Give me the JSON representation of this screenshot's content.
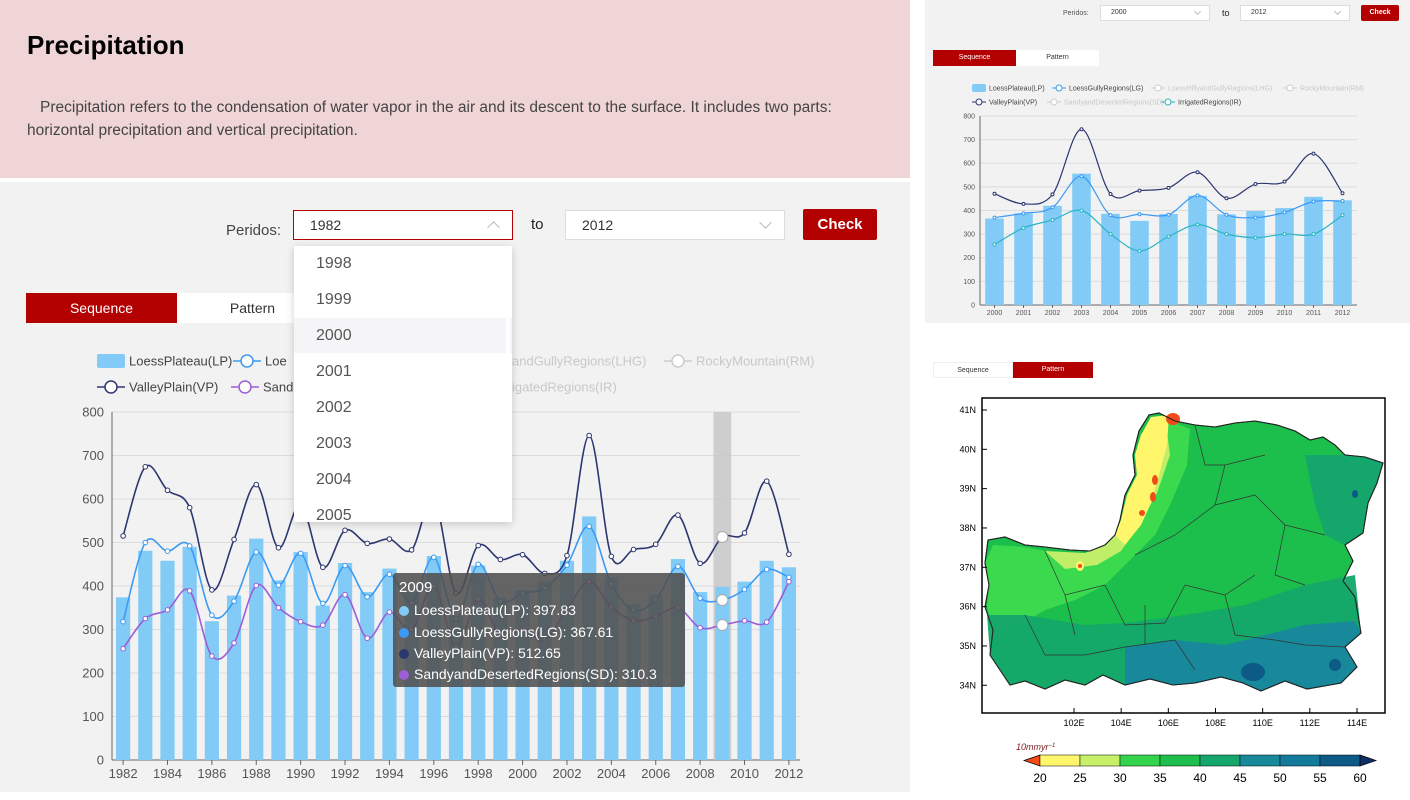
{
  "header": {
    "title": "Precipitation",
    "description": "Precipitation refers to the condensation of water vapor in the air and its descent to the surface. It includes two parts: horizontal precipitation and vertical precipitation."
  },
  "left": {
    "periods_label": "Peridos:",
    "from_value": "1982",
    "to_label": "to",
    "to_value": "2012",
    "check_label": "Check",
    "tabs": [
      "Sequence",
      "Pattern"
    ],
    "dropdown_options": [
      "1998",
      "1999",
      "2000",
      "2001",
      "2002",
      "2003",
      "2004",
      "2005"
    ],
    "legend": [
      {
        "text": "LoessPlateau(LP)",
        "style": "bar",
        "color": "#82cbf7",
        "dim": false
      },
      {
        "text": "Loe",
        "style": "line",
        "color": "#3b9af3",
        "dim": false
      },
      {
        "text": "andGullyRegions(LHG)",
        "style": "none",
        "color": "#cccccc",
        "dim": true
      },
      {
        "text": "RockyMountain(RM)",
        "style": "line",
        "color": "#cccccc",
        "dim": true
      },
      {
        "text": "ValleyPlain(VP)",
        "style": "line",
        "color": "#2c3670",
        "dim": false
      },
      {
        "text": "Sand",
        "style": "line",
        "color": "#9b5ed6",
        "dim": false
      },
      {
        "text": "igatedRegions(IR)",
        "style": "none",
        "color": "#cccccc",
        "dim": true
      }
    ],
    "tooltip": {
      "title": "2009",
      "rows": [
        {
          "text": "LoessPlateau(LP): 397.83",
          "color": "#82cbf7"
        },
        {
          "text": "LoessGullyRegions(LG): 367.61",
          "color": "#3b9af3"
        },
        {
          "text": "ValleyPlain(VP): 512.65",
          "color": "#2c3670"
        },
        {
          "text": "SandyandDesertedRegions(SD): 310.3",
          "color": "#9b5ed6"
        }
      ]
    }
  },
  "chart_data": [
    {
      "type": "bar",
      "x": [
        1982,
        1983,
        1984,
        1985,
        1986,
        1987,
        1988,
        1989,
        1990,
        1991,
        1992,
        1993,
        1994,
        1995,
        1996,
        1997,
        1998,
        1999,
        2000,
        2001,
        2002,
        2003,
        2004,
        2005,
        2006,
        2007,
        2008,
        2009,
        2010,
        2011,
        2012
      ],
      "ylim": [
        0,
        800
      ],
      "yticks": [
        0,
        100,
        200,
        300,
        400,
        500,
        600,
        700,
        800
      ],
      "xticks": [
        1982,
        1984,
        1986,
        1988,
        1990,
        1992,
        1994,
        1996,
        1998,
        2000,
        2002,
        2004,
        2006,
        2008,
        2010,
        2012
      ],
      "highlight_x": 2009,
      "series": [
        {
          "name": "LoessPlateau(LP)",
          "type": "bar",
          "color": "#82cbf7",
          "values": [
            374,
            481,
            458,
            490,
            319,
            378,
            509,
            413,
            478,
            355,
            453,
            386,
            440,
            387,
            469,
            331,
            447,
            373,
            391,
            411,
            458,
            560,
            420,
            358,
            380,
            462,
            386,
            398,
            410,
            458,
            443
          ]
        },
        {
          "name": "LoessGullyRegions(LG)",
          "type": "line",
          "color": "#3b9af3",
          "values": [
            318,
            500,
            480,
            492,
            333,
            365,
            478,
            402,
            475,
            360,
            447,
            375,
            427,
            362,
            466,
            325,
            450,
            365,
            383,
            395,
            448,
            537,
            405,
            345,
            368,
            445,
            372,
            367.61,
            392,
            438,
            420
          ]
        },
        {
          "name": "ValleyPlain(VP)",
          "type": "line",
          "color": "#2c3670",
          "values": [
            515,
            674,
            620,
            580,
            391,
            507,
            633,
            488,
            587,
            443,
            528,
            498,
            508,
            483,
            601,
            384,
            493,
            461,
            472,
            429,
            470,
            746,
            468,
            484,
            496,
            563,
            452,
            512.65,
            522,
            641,
            473
          ]
        },
        {
          "name": "SandyandDesertedRegions(SD)",
          "type": "line",
          "color": "#9b5ed6",
          "values": [
            256,
            325,
            345,
            389,
            239,
            269,
            401,
            350,
            318,
            310,
            380,
            280,
            340,
            300,
            400,
            260,
            370,
            286,
            300,
            276,
            347,
            410,
            352,
            320,
            330,
            350,
            304,
            310.3,
            320,
            317,
            410
          ]
        }
      ]
    },
    {
      "type": "bar",
      "x": [
        2000,
        2001,
        2002,
        2003,
        2004,
        2005,
        2006,
        2007,
        2008,
        2009,
        2010,
        2011,
        2012
      ],
      "ylim": [
        0,
        800
      ],
      "yticks": [
        0,
        100,
        200,
        300,
        400,
        500,
        600,
        700,
        800
      ],
      "series": [
        {
          "name": "LoessPlateau(LP)",
          "type": "bar",
          "color": "#82cbf7",
          "values": [
            366,
            388,
            420,
            556,
            386,
            356,
            385,
            462,
            384,
            398,
            410,
            458,
            443
          ]
        },
        {
          "name": "LoessGullyRegions(LG)",
          "type": "line",
          "color": "#3b9af3",
          "values": [
            370,
            388,
            413,
            545,
            380,
            384,
            382,
            464,
            382,
            370,
            392,
            438,
            440
          ]
        },
        {
          "name": "ValleyPlain(VP)",
          "type": "line",
          "color": "#2c3670",
          "values": [
            471,
            428,
            468,
            744,
            470,
            484,
            496,
            562,
            452,
            512,
            522,
            641,
            473
          ]
        },
        {
          "name": "IrrigatedRegions(IR)",
          "type": "line",
          "color": "#2ab5c4",
          "values": [
            256,
            326,
            360,
            400,
            300,
            229,
            290,
            340,
            300,
            285,
            300,
            300,
            380
          ]
        }
      ]
    },
    {
      "type": "heatmap",
      "x_ticks": [
        "102E",
        "104E",
        "106E",
        "108E",
        "110E",
        "112E",
        "114E"
      ],
      "y_ticks": [
        "41N",
        "40N",
        "39N",
        "38N",
        "37N",
        "36N",
        "35N",
        "34N"
      ],
      "unit": "10mmyr",
      "unit_exp": "−1",
      "colorbar_ticks": [
        20,
        25,
        30,
        35,
        40,
        45,
        50,
        55,
        60
      ],
      "colorbar_colors": [
        "#f24b1a",
        "#fff66c",
        "#c7ef6a",
        "#33d44c",
        "#1cbf4c",
        "#14a66a",
        "#17899a",
        "#127b9b",
        "#0d5a86"
      ]
    }
  ],
  "right": {
    "periods_label": "Peridos:",
    "from_value": "2000",
    "to_label": "to",
    "to_value": "2012",
    "check_label": "Check",
    "tabs": [
      "Sequence",
      "Pattern"
    ],
    "legend": [
      {
        "text": "LoessPlateau(LP)",
        "style": "bar",
        "color": "#82cbf7",
        "dim": false
      },
      {
        "text": "LoessGullyRegions(LG)",
        "style": "line",
        "color": "#3b9af3",
        "dim": false
      },
      {
        "text": "LoessHillyandGullyRegions(LHG)",
        "style": "line",
        "color": "#cccccc",
        "dim": true
      },
      {
        "text": "RockyMountain(RM)",
        "style": "line",
        "color": "#cccccc",
        "dim": true
      },
      {
        "text": "ValleyPlain(VP)",
        "style": "line",
        "color": "#2c3670",
        "dim": false
      },
      {
        "text": "SandyandDesertedRegions(SD)",
        "style": "line",
        "color": "#cccccc",
        "dim": true
      },
      {
        "text": "IrrigatedRegions(IR)",
        "style": "line",
        "color": "#2ab5c4",
        "dim": false
      }
    ]
  }
}
